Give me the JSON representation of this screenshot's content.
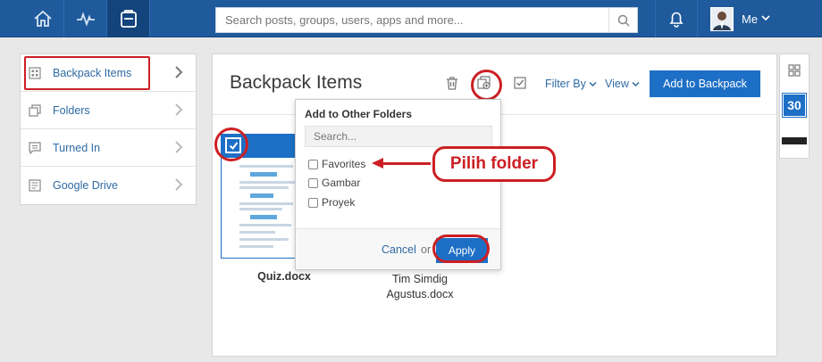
{
  "topbar": {
    "search_placeholder": "Search posts, groups, users, apps and more...",
    "user_label": "Me",
    "icons": [
      "home-icon",
      "activity-icon",
      "backpack-icon",
      "search-icon",
      "bell-icon",
      "chevron-down-icon"
    ]
  },
  "sidebar": {
    "items": [
      {
        "label": "Backpack Items",
        "icon": "grid-icon"
      },
      {
        "label": "Folders",
        "icon": "folders-icon"
      },
      {
        "label": "Turned In",
        "icon": "chat-icon"
      },
      {
        "label": "Google Drive",
        "icon": "doc-icon"
      }
    ]
  },
  "main": {
    "title": "Backpack Items",
    "filter_label": "Filter By",
    "view_label": "View",
    "add_button": "Add to Backpack",
    "files": [
      {
        "name": "Quiz.docx"
      },
      {
        "name_line1": "Tim Simdig",
        "name_line2": "Agustus.docx"
      }
    ]
  },
  "dropdown": {
    "title": "Add to Other Folders",
    "search_placeholder": "Search...",
    "options": [
      "Favorites",
      "Gambar",
      "Proyek"
    ],
    "cancel_label": "Cancel",
    "or_label": "or",
    "apply_label": "Apply"
  },
  "annotation": {
    "callout_text": "Pilih folder"
  },
  "rail": {
    "calendar_number": "30"
  },
  "colors": {
    "topbar": "#1f5a9c",
    "accent": "#1d6fc6",
    "highlight": "#cc1f24",
    "link": "#2f6aa3"
  }
}
